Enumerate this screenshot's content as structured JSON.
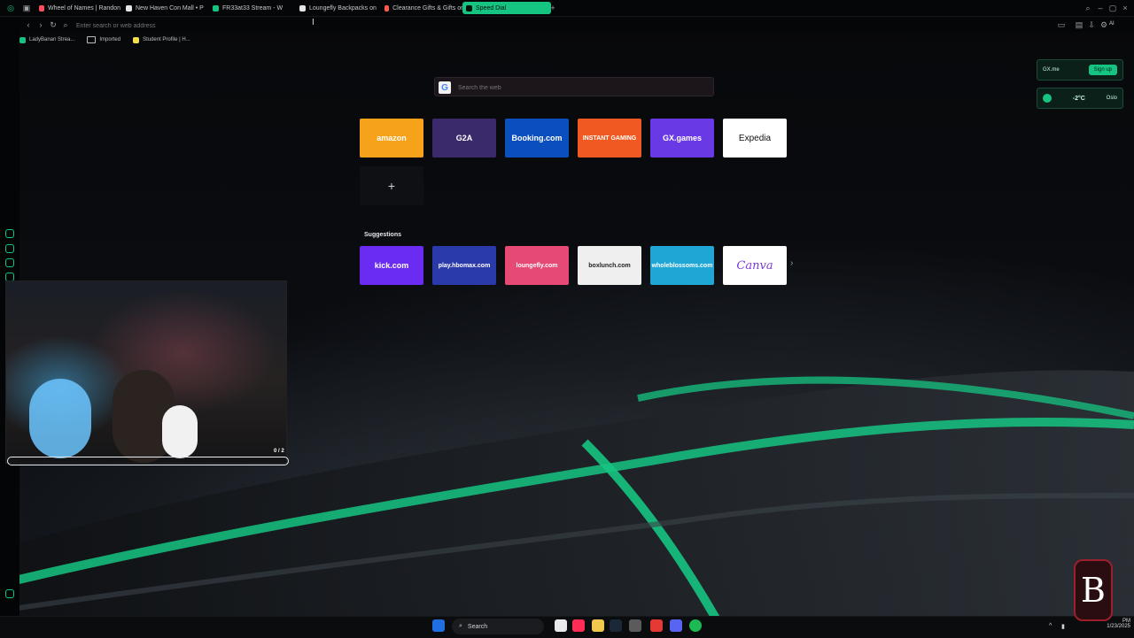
{
  "browser": {
    "tabs": [
      {
        "label": "Wheel of Names | Randon"
      },
      {
        "label": "New Haven Con Mall • P"
      },
      {
        "label": "FR33at33 Stream - W"
      },
      {
        "label": "Loungefly Backpacks on"
      },
      {
        "label": "Clearance Gifts & Gifts on"
      },
      {
        "label": "Speed Dial",
        "active": true
      }
    ],
    "address_placeholder": "Enter search or web address",
    "bookmarks": [
      {
        "label": "LadyBanan Strea..."
      },
      {
        "label": "Imported"
      },
      {
        "label": "Student Profile | H..."
      }
    ],
    "toolbar_right_label": "AI"
  },
  "speed_dial": {
    "search_placeholder": "Search the web",
    "tiles": [
      {
        "label": "amazon",
        "bg": "#f7a21b"
      },
      {
        "label": "G2A",
        "bg": "#3b2a6b"
      },
      {
        "label": "Booking.com",
        "bg": "#0b4fbf"
      },
      {
        "label": "INSTANT GAMING",
        "bg": "#f05a22"
      },
      {
        "label": "GX.games",
        "bg": "#6a39e6"
      },
      {
        "label": "Expedia",
        "bg": "#ffffff"
      }
    ],
    "add_label": "+",
    "suggestions_title": "Suggestions",
    "suggestions": [
      {
        "label": "kick.com",
        "bg": "#6a2cf2"
      },
      {
        "label": "play.hbomax.com",
        "bg": "#2a3aa8"
      },
      {
        "label": "loungefly.com",
        "bg": "#e64a74"
      },
      {
        "label": "boxlunch.com",
        "bg": "#efefef"
      },
      {
        "label": "wholeblossoms.com",
        "bg": "#1fa6d5"
      },
      {
        "label": "Canva",
        "bg": "#ffffff"
      }
    ],
    "next_label": "›"
  },
  "widgets": {
    "gx_label": "GX.me",
    "signup_label": "Sign up",
    "weather_temp": "-2°C",
    "weather_extra": "Oslo"
  },
  "stream": {
    "progress_text": "0 / 2",
    "progress_fraction": 0.0
  },
  "taskbar": {
    "search_label": "Search",
    "time_label": "PM",
    "date_label": "1/23/2025"
  },
  "overlay": {
    "watermark_text": "B"
  }
}
